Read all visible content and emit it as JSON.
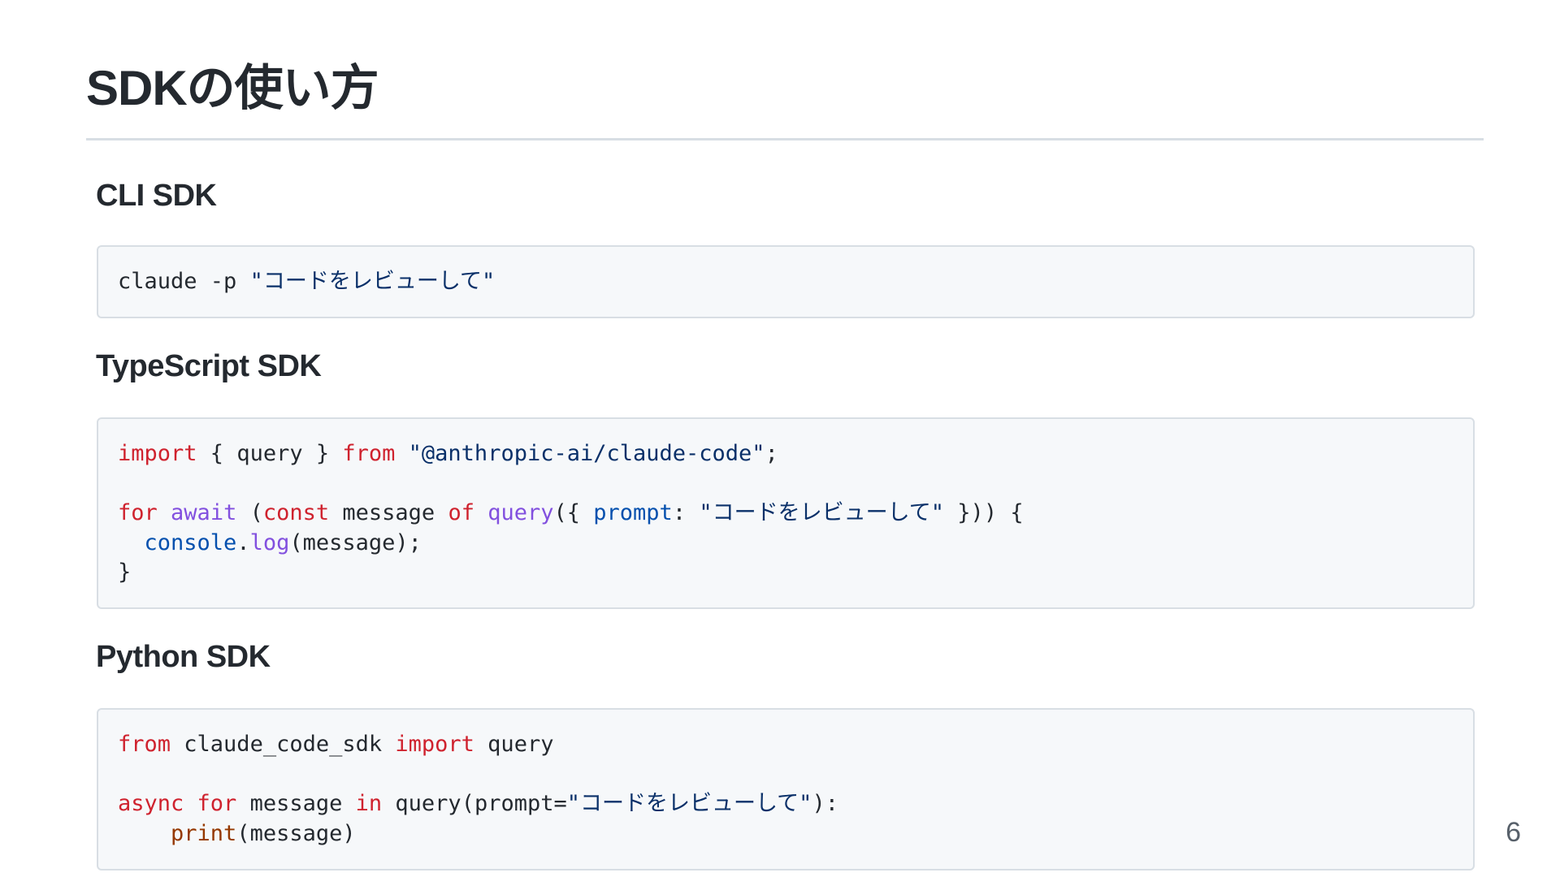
{
  "slide": {
    "title": "SDKの使い方",
    "page_number": "6"
  },
  "sections": [
    {
      "heading": "CLI SDK",
      "code": [
        [
          {
            "t": "claude -p ",
            "c": ""
          },
          {
            "t": "\"コードをレビューして\"",
            "c": "str"
          }
        ]
      ]
    },
    {
      "heading": "TypeScript SDK",
      "code": [
        [
          {
            "t": "import",
            "c": "kw"
          },
          {
            "t": " { query } ",
            "c": ""
          },
          {
            "t": "from",
            "c": "kw"
          },
          {
            "t": " ",
            "c": ""
          },
          {
            "t": "\"@anthropic-ai/claude-code\"",
            "c": "str"
          },
          {
            "t": ";",
            "c": ""
          }
        ],
        [],
        [
          {
            "t": "for",
            "c": "kw"
          },
          {
            "t": " ",
            "c": ""
          },
          {
            "t": "await",
            "c": "kw2"
          },
          {
            "t": " (",
            "c": ""
          },
          {
            "t": "const",
            "c": "kw"
          },
          {
            "t": " message ",
            "c": ""
          },
          {
            "t": "of",
            "c": "kw"
          },
          {
            "t": " ",
            "c": ""
          },
          {
            "t": "query",
            "c": "fn"
          },
          {
            "t": "({ ",
            "c": ""
          },
          {
            "t": "prompt",
            "c": "prop"
          },
          {
            "t": ": ",
            "c": ""
          },
          {
            "t": "\"コードをレビューして\"",
            "c": "str"
          },
          {
            "t": " })) {",
            "c": ""
          }
        ],
        [
          {
            "t": "  ",
            "c": ""
          },
          {
            "t": "console",
            "c": "prop"
          },
          {
            "t": ".",
            "c": ""
          },
          {
            "t": "log",
            "c": "fn"
          },
          {
            "t": "(message);",
            "c": ""
          }
        ],
        [
          {
            "t": "}",
            "c": ""
          }
        ]
      ]
    },
    {
      "heading": "Python SDK",
      "code": [
        [
          {
            "t": "from",
            "c": "kw"
          },
          {
            "t": " claude_code_sdk ",
            "c": ""
          },
          {
            "t": "import",
            "c": "kw"
          },
          {
            "t": " query",
            "c": ""
          }
        ],
        [],
        [
          {
            "t": "async",
            "c": "kw"
          },
          {
            "t": " ",
            "c": ""
          },
          {
            "t": "for",
            "c": "kw"
          },
          {
            "t": " message ",
            "c": ""
          },
          {
            "t": "in",
            "c": "kw"
          },
          {
            "t": " query(prompt=",
            "c": ""
          },
          {
            "t": "\"コードをレビューして\"",
            "c": "str"
          },
          {
            "t": "):",
            "c": ""
          }
        ],
        [
          {
            "t": "    ",
            "c": ""
          },
          {
            "t": "print",
            "c": "builtin"
          },
          {
            "t": "(message)",
            "c": ""
          }
        ]
      ]
    }
  ],
  "colors": {
    "keyword": "#cf222e",
    "keyword_alt": "#8250df",
    "string": "#0a3069",
    "property": "#0550ae",
    "builtin": "#953800",
    "code_background": "#f6f8fa",
    "border": "#d8dee4"
  }
}
